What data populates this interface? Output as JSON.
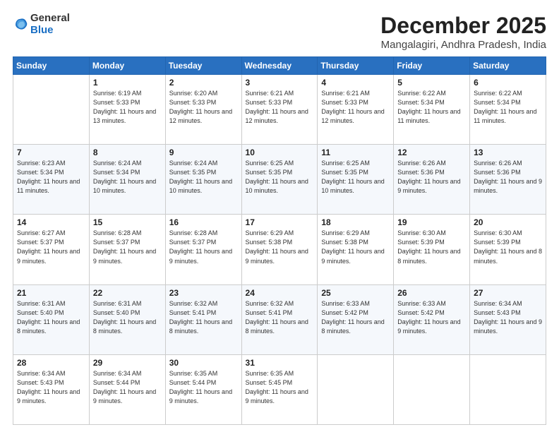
{
  "logo": {
    "general": "General",
    "blue": "Blue"
  },
  "title": {
    "month": "December 2025",
    "location": "Mangalagiri, Andhra Pradesh, India"
  },
  "headers": [
    "Sunday",
    "Monday",
    "Tuesday",
    "Wednesday",
    "Thursday",
    "Friday",
    "Saturday"
  ],
  "weeks": [
    [
      {
        "day": "",
        "sunrise": "",
        "sunset": "",
        "daylight": ""
      },
      {
        "day": "1",
        "sunrise": "6:19 AM",
        "sunset": "5:33 PM",
        "daylight": "11 hours and 13 minutes."
      },
      {
        "day": "2",
        "sunrise": "6:20 AM",
        "sunset": "5:33 PM",
        "daylight": "11 hours and 12 minutes."
      },
      {
        "day": "3",
        "sunrise": "6:21 AM",
        "sunset": "5:33 PM",
        "daylight": "11 hours and 12 minutes."
      },
      {
        "day": "4",
        "sunrise": "6:21 AM",
        "sunset": "5:33 PM",
        "daylight": "11 hours and 12 minutes."
      },
      {
        "day": "5",
        "sunrise": "6:22 AM",
        "sunset": "5:34 PM",
        "daylight": "11 hours and 11 minutes."
      },
      {
        "day": "6",
        "sunrise": "6:22 AM",
        "sunset": "5:34 PM",
        "daylight": "11 hours and 11 minutes."
      }
    ],
    [
      {
        "day": "7",
        "sunrise": "6:23 AM",
        "sunset": "5:34 PM",
        "daylight": "11 hours and 11 minutes."
      },
      {
        "day": "8",
        "sunrise": "6:24 AM",
        "sunset": "5:34 PM",
        "daylight": "11 hours and 10 minutes."
      },
      {
        "day": "9",
        "sunrise": "6:24 AM",
        "sunset": "5:35 PM",
        "daylight": "11 hours and 10 minutes."
      },
      {
        "day": "10",
        "sunrise": "6:25 AM",
        "sunset": "5:35 PM",
        "daylight": "11 hours and 10 minutes."
      },
      {
        "day": "11",
        "sunrise": "6:25 AM",
        "sunset": "5:35 PM",
        "daylight": "11 hours and 10 minutes."
      },
      {
        "day": "12",
        "sunrise": "6:26 AM",
        "sunset": "5:36 PM",
        "daylight": "11 hours and 9 minutes."
      },
      {
        "day": "13",
        "sunrise": "6:26 AM",
        "sunset": "5:36 PM",
        "daylight": "11 hours and 9 minutes."
      }
    ],
    [
      {
        "day": "14",
        "sunrise": "6:27 AM",
        "sunset": "5:37 PM",
        "daylight": "11 hours and 9 minutes."
      },
      {
        "day": "15",
        "sunrise": "6:28 AM",
        "sunset": "5:37 PM",
        "daylight": "11 hours and 9 minutes."
      },
      {
        "day": "16",
        "sunrise": "6:28 AM",
        "sunset": "5:37 PM",
        "daylight": "11 hours and 9 minutes."
      },
      {
        "day": "17",
        "sunrise": "6:29 AM",
        "sunset": "5:38 PM",
        "daylight": "11 hours and 9 minutes."
      },
      {
        "day": "18",
        "sunrise": "6:29 AM",
        "sunset": "5:38 PM",
        "daylight": "11 hours and 9 minutes."
      },
      {
        "day": "19",
        "sunrise": "6:30 AM",
        "sunset": "5:39 PM",
        "daylight": "11 hours and 8 minutes."
      },
      {
        "day": "20",
        "sunrise": "6:30 AM",
        "sunset": "5:39 PM",
        "daylight": "11 hours and 8 minutes."
      }
    ],
    [
      {
        "day": "21",
        "sunrise": "6:31 AM",
        "sunset": "5:40 PM",
        "daylight": "11 hours and 8 minutes."
      },
      {
        "day": "22",
        "sunrise": "6:31 AM",
        "sunset": "5:40 PM",
        "daylight": "11 hours and 8 minutes."
      },
      {
        "day": "23",
        "sunrise": "6:32 AM",
        "sunset": "5:41 PM",
        "daylight": "11 hours and 8 minutes."
      },
      {
        "day": "24",
        "sunrise": "6:32 AM",
        "sunset": "5:41 PM",
        "daylight": "11 hours and 8 minutes."
      },
      {
        "day": "25",
        "sunrise": "6:33 AM",
        "sunset": "5:42 PM",
        "daylight": "11 hours and 8 minutes."
      },
      {
        "day": "26",
        "sunrise": "6:33 AM",
        "sunset": "5:42 PM",
        "daylight": "11 hours and 9 minutes."
      },
      {
        "day": "27",
        "sunrise": "6:34 AM",
        "sunset": "5:43 PM",
        "daylight": "11 hours and 9 minutes."
      }
    ],
    [
      {
        "day": "28",
        "sunrise": "6:34 AM",
        "sunset": "5:43 PM",
        "daylight": "11 hours and 9 minutes."
      },
      {
        "day": "29",
        "sunrise": "6:34 AM",
        "sunset": "5:44 PM",
        "daylight": "11 hours and 9 minutes."
      },
      {
        "day": "30",
        "sunrise": "6:35 AM",
        "sunset": "5:44 PM",
        "daylight": "11 hours and 9 minutes."
      },
      {
        "day": "31",
        "sunrise": "6:35 AM",
        "sunset": "5:45 PM",
        "daylight": "11 hours and 9 minutes."
      },
      {
        "day": "",
        "sunrise": "",
        "sunset": "",
        "daylight": ""
      },
      {
        "day": "",
        "sunrise": "",
        "sunset": "",
        "daylight": ""
      },
      {
        "day": "",
        "sunrise": "",
        "sunset": "",
        "daylight": ""
      }
    ]
  ]
}
